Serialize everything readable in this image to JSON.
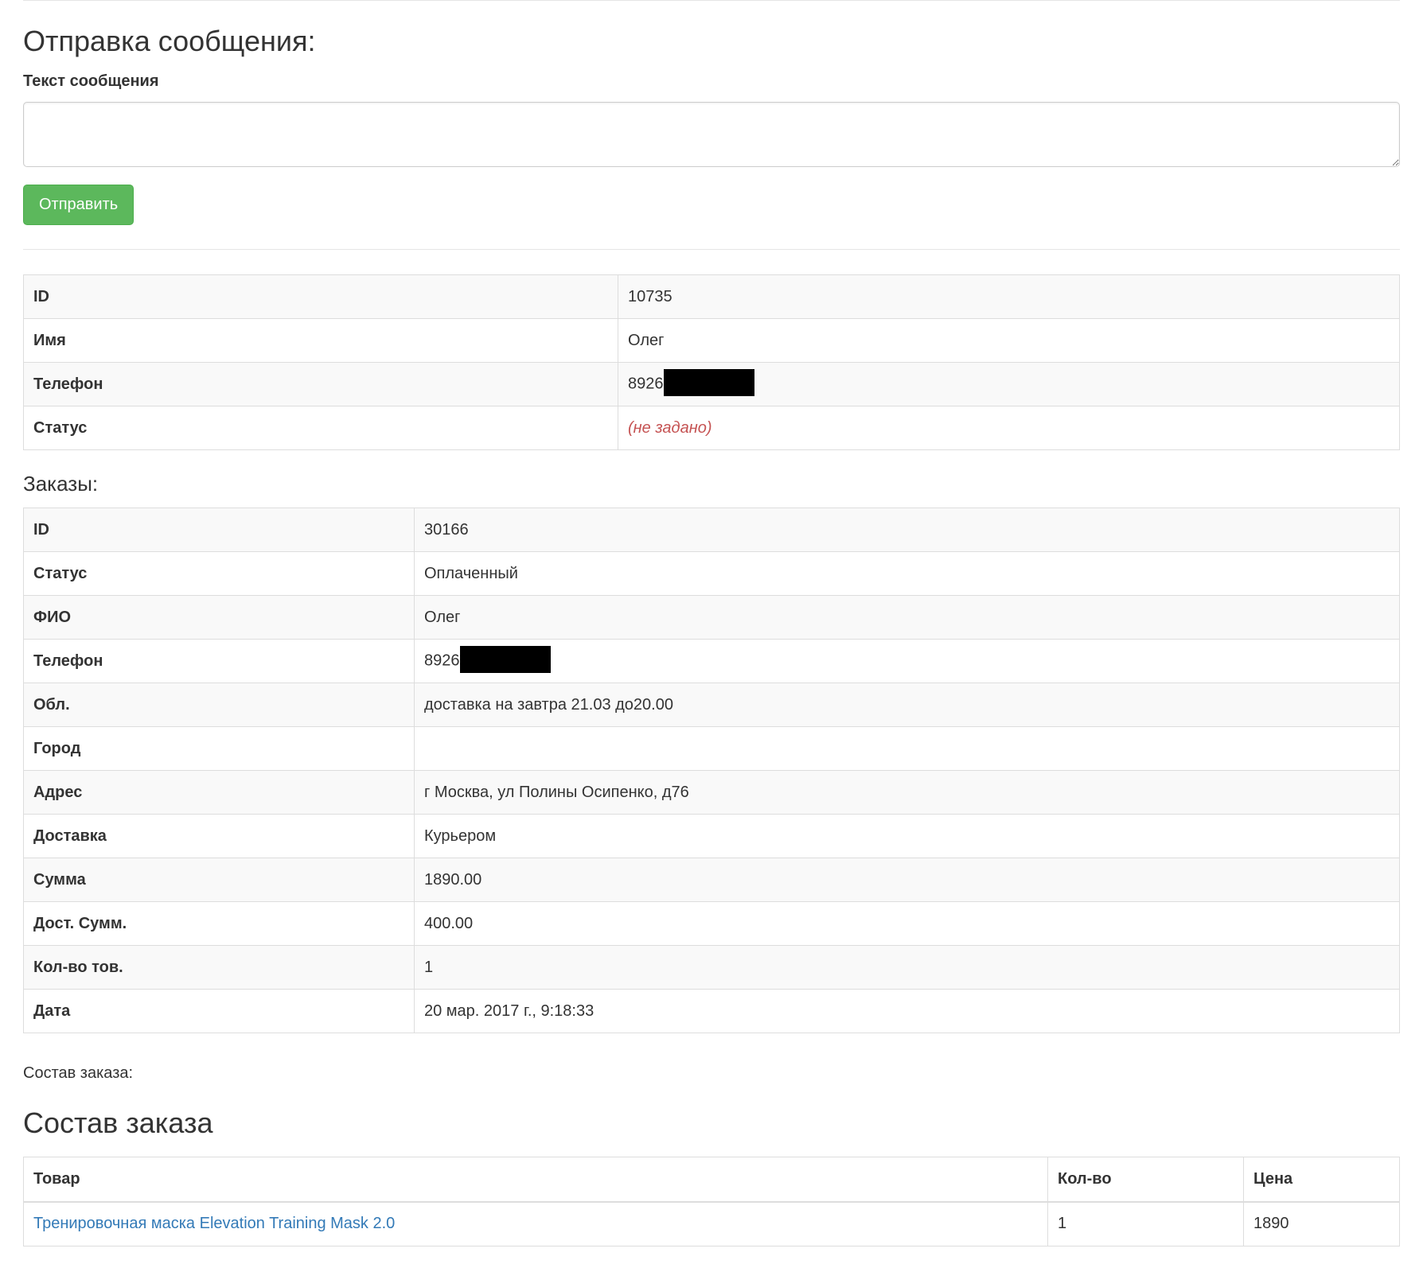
{
  "message_form": {
    "title": "Отправка сообщения:",
    "field_label": "Текст сообщения",
    "textarea_value": "",
    "send_label": "Отправить"
  },
  "user": {
    "rows": [
      {
        "key": "ID",
        "value": "10735"
      },
      {
        "key": "Имя",
        "value": "Олег"
      },
      {
        "key": "Телефон",
        "value": "8926",
        "redacted": true
      },
      {
        "key": "Статус",
        "value": "(не задано)",
        "not_set": true
      }
    ]
  },
  "orders": {
    "heading": "Заказы:",
    "rows": [
      {
        "key": "ID",
        "value": "30166"
      },
      {
        "key": "Статус",
        "value": "Оплаченный"
      },
      {
        "key": "ФИО",
        "value": "Олег"
      },
      {
        "key": "Телефон",
        "value": "8926",
        "redacted": true
      },
      {
        "key": "Обл.",
        "value": "доставка на завтра 21.03 до20.00"
      },
      {
        "key": "Город",
        "value": ""
      },
      {
        "key": "Адрес",
        "value": "г Москва, ул Полины Осипенко, д76"
      },
      {
        "key": "Доставка",
        "value": "Курьером"
      },
      {
        "key": "Сумма",
        "value": "1890.00"
      },
      {
        "key": "Дост. Сумм.",
        "value": "400.00"
      },
      {
        "key": "Кол-во тов.",
        "value": "1"
      },
      {
        "key": "Дата",
        "value": "20 мар. 2017 г., 9:18:33"
      }
    ]
  },
  "composition": {
    "caption": "Состав заказа:",
    "title": "Состав заказа",
    "headers": {
      "product": "Товар",
      "qty": "Кол-во",
      "price": "Цена"
    },
    "items": [
      {
        "product": "Тренировочная маска Elevation Training Mask 2.0",
        "qty": "1",
        "price": "1890"
      }
    ]
  },
  "colors": {
    "button": "#5cb85c",
    "link": "#337ab7",
    "not_set": "#c55353",
    "stripe": "#f9f9f9",
    "border": "#dddddd"
  }
}
